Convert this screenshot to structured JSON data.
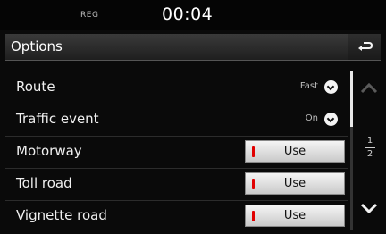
{
  "status": {
    "reg": "REG",
    "time": "00:04"
  },
  "header": {
    "title": "Options",
    "back_icon": "back-arrow-icon"
  },
  "options": {
    "route": {
      "label": "Route",
      "value": "Fast"
    },
    "traffic": {
      "label": "Traffic event",
      "value": "On"
    },
    "motorway": {
      "label": "Motorway",
      "button": "Use"
    },
    "toll": {
      "label": "Toll road",
      "button": "Use"
    },
    "vignette": {
      "label": "Vignette road",
      "button": "Use"
    }
  },
  "pagination": {
    "current": "1",
    "total": "2"
  },
  "colors": {
    "indicator": "#e10000",
    "background": "#0a0a0a"
  }
}
